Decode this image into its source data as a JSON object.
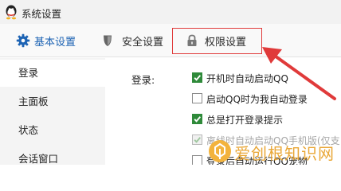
{
  "window": {
    "title": "系统设置"
  },
  "tabs": [
    {
      "label": "基本设置",
      "icon": "gear-icon"
    },
    {
      "label": "安全设置",
      "icon": "shield-icon"
    },
    {
      "label": "权限设置",
      "icon": "lock-icon"
    }
  ],
  "sidebar": {
    "items": [
      {
        "label": "登录"
      },
      {
        "label": "主面板"
      },
      {
        "label": "状态"
      },
      {
        "label": "会话窗口"
      }
    ]
  },
  "login_section": {
    "label": "登录:",
    "options": [
      {
        "label": "开机时自动启动QQ",
        "checked": true,
        "disabled": false
      },
      {
        "label": "启动QQ时为我自动登录",
        "checked": false,
        "disabled": false
      },
      {
        "label": "总是打开登录提示",
        "checked": true,
        "disabled": false
      },
      {
        "label": "离线时自动启动QQ手机版(仅支",
        "checked": true,
        "disabled": true
      },
      {
        "label": "登录后自动运行QQ宠物",
        "checked": false,
        "disabled": false
      }
    ]
  },
  "watermark": {
    "text": "爱创根知识网"
  },
  "colors": {
    "accent": "#1e64b4",
    "check": "#2f8a3a",
    "annotation": "#e03a3a",
    "watermark": "#e8a027"
  }
}
